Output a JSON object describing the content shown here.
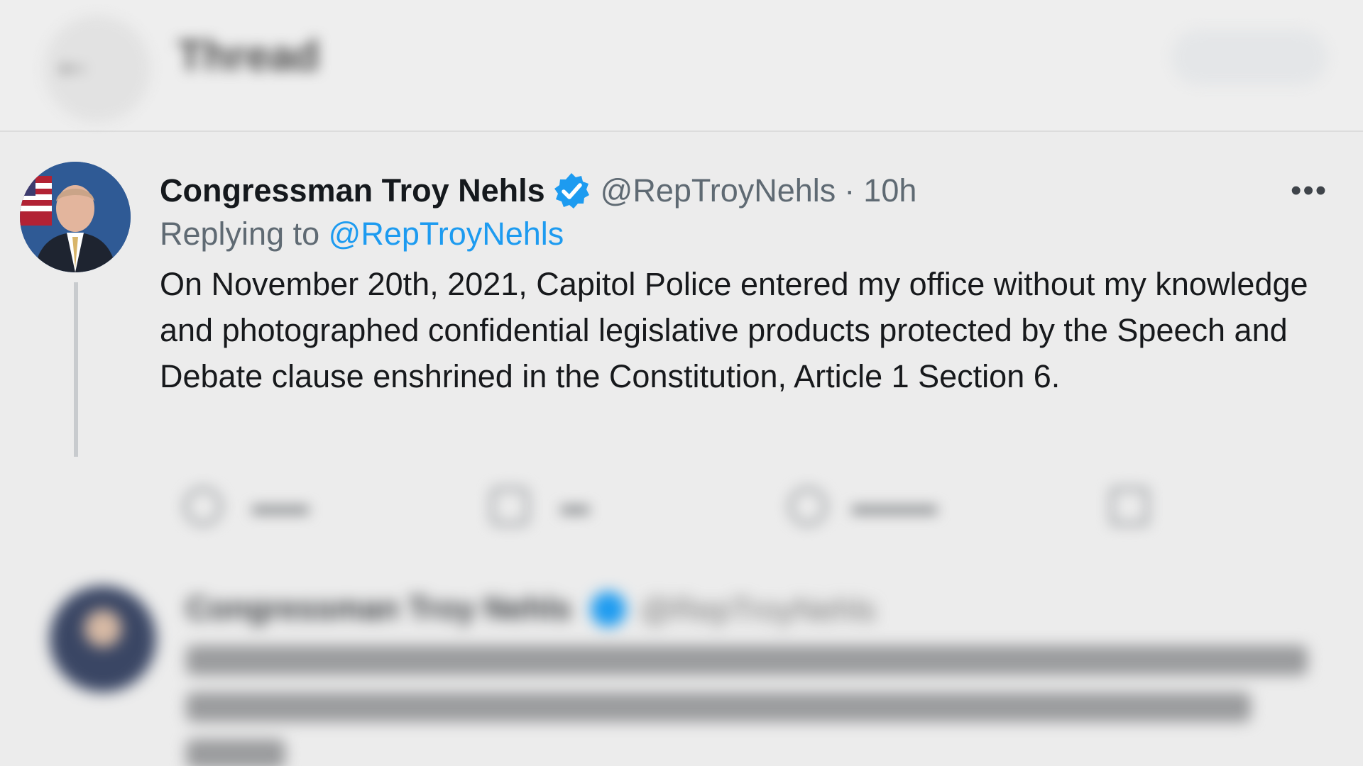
{
  "header": {
    "back_icon": "arrow-left-icon",
    "title": "Thread"
  },
  "tweet": {
    "display_name": "Congressman Troy Nehls",
    "verified_icon": "verified-badge-icon",
    "handle": "@RepTroyNehls",
    "separator": "·",
    "time": "10h",
    "more_label": "•••",
    "replying_prefix": "Replying to",
    "replying_to": "@RepTroyNehls",
    "text": "On November 20th, 2021, Capitol Police entered my office without my knowledge and photographed confidential legislative products protected by the Speech and Debate clause enshrined in the Constitution, Article 1 Section 6."
  },
  "actions": [
    {
      "icon": "reply-icon"
    },
    {
      "icon": "retweet-icon"
    },
    {
      "icon": "like-icon"
    },
    {
      "icon": "share-icon"
    }
  ],
  "colors": {
    "link": "#1d9bf0",
    "verified": "#1d9bf0",
    "background": "#ececec"
  }
}
